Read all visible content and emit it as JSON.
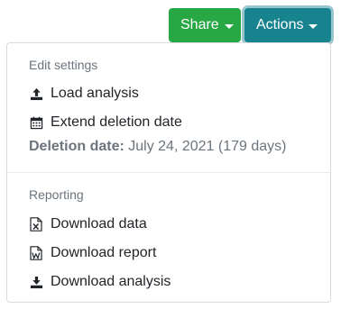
{
  "buttons": {
    "share_label": "Share",
    "actions_label": "Actions"
  },
  "menu": {
    "edit_section": {
      "header": "Edit settings",
      "items": [
        {
          "label": "Load analysis",
          "icon": "upload-icon"
        },
        {
          "label": "Extend deletion date",
          "icon": "calendar-icon"
        }
      ],
      "deletion_label": "Deletion date:",
      "deletion_value": "July 24, 2021 (179 days)"
    },
    "reporting_section": {
      "header": "Reporting",
      "items": [
        {
          "label": "Download data",
          "icon": "excel-file-icon"
        },
        {
          "label": "Download report",
          "icon": "word-file-icon"
        },
        {
          "label": "Download analysis",
          "icon": "download-icon"
        }
      ]
    }
  },
  "colors": {
    "share_button": "#28a745",
    "actions_button": "#17838f",
    "muted_text": "#6c757d",
    "body_text": "#212529"
  }
}
